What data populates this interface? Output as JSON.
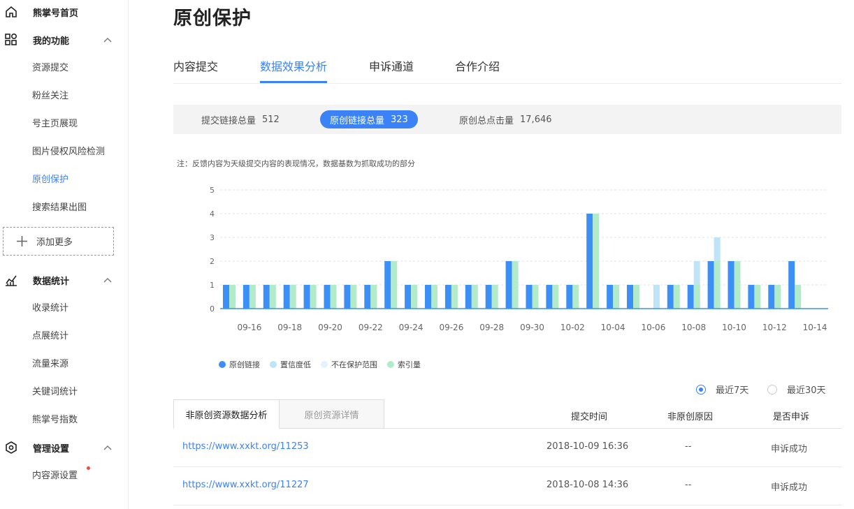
{
  "sidebar": {
    "home": {
      "label": "熊掌号首页"
    },
    "sections": [
      {
        "label": "我的功能",
        "items": [
          {
            "label": "资源提交"
          },
          {
            "label": "粉丝关注"
          },
          {
            "label": "号主页展现"
          },
          {
            "label": "图片侵权风险检测"
          },
          {
            "label": "原创保护"
          },
          {
            "label": "搜索结果出图"
          }
        ]
      },
      {
        "label": "数据统计",
        "items": [
          {
            "label": "收录统计"
          },
          {
            "label": "点展统计"
          },
          {
            "label": "流量来源"
          },
          {
            "label": "关键词统计"
          },
          {
            "label": "熊掌号指数"
          }
        ]
      },
      {
        "label": "管理设置",
        "items": [
          {
            "label": "内容源设置"
          }
        ]
      }
    ],
    "add_more": "添加更多"
  },
  "page": {
    "title": "原创保护"
  },
  "tabs": [
    "内容提交",
    "数据效果分析",
    "申诉通道",
    "合作介绍"
  ],
  "active_tab": 1,
  "stats": [
    {
      "label": "提交链接总量",
      "value": "512"
    },
    {
      "label": "原创链接总量",
      "value": "323"
    },
    {
      "label": "原创总点击量",
      "value": "17,646"
    }
  ],
  "note": "注：反馈内容为天级提交内容的表现情况，数据基数为抓取成功的部分",
  "range": {
    "option1": "最近7天",
    "option2": "最近30天",
    "selected": 0
  },
  "table": {
    "tab_active": "非原创资源数据分析",
    "tab_inactive": "原创资源详情",
    "headers": {
      "time": "提交时间",
      "reason": "非原创原因",
      "appeal": "是否申诉"
    },
    "rows": [
      {
        "url": "https://www.xxkt.org/11253",
        "time": "2018-10-09 16:36",
        "reason": "--",
        "appeal": "申诉成功"
      },
      {
        "url": "https://www.xxkt.org/11227",
        "time": "2018-10-08 14:36",
        "reason": "--",
        "appeal": "申诉成功"
      }
    ]
  },
  "colors": {
    "accent": "#3b82f6",
    "series": [
      "#3b8ff5",
      "#bfe3f7",
      "#e4f2fb",
      "#b1ebc9"
    ]
  },
  "chart_data": {
    "type": "bar",
    "categories": [
      "09-15",
      "09-16",
      "09-17",
      "09-18",
      "09-19",
      "09-20",
      "09-21",
      "09-22",
      "09-23",
      "09-24",
      "09-25",
      "09-26",
      "09-27",
      "09-28",
      "09-29",
      "09-30",
      "10-01",
      "10-02",
      "10-03",
      "10-04",
      "10-05",
      "10-06",
      "10-07",
      "10-08",
      "10-09",
      "10-10",
      "10-11",
      "10-12",
      "10-13",
      "10-14"
    ],
    "tick_labels": [
      "09-16",
      "09-18",
      "09-20",
      "09-22",
      "09-24",
      "09-26",
      "09-28",
      "09-30",
      "10-02",
      "10-04",
      "10-06",
      "10-08",
      "10-10",
      "10-12",
      "10-14"
    ],
    "series": [
      {
        "name": "原创链接",
        "color": "#3b8ff5",
        "values": [
          1,
          1,
          1,
          1,
          1,
          1,
          1,
          1,
          2,
          1,
          1,
          1,
          1,
          1,
          2,
          1,
          1,
          1,
          4,
          1,
          1,
          0,
          1,
          1,
          2,
          2,
          1,
          1,
          2,
          0
        ]
      },
      {
        "name": "置信度低",
        "color": "#bfe3f7",
        "values": [
          0,
          0,
          0,
          0,
          0,
          0,
          0,
          0,
          0,
          0,
          0,
          0,
          0,
          0,
          0,
          0,
          0,
          0,
          0,
          0,
          0,
          1,
          0,
          2,
          3,
          0,
          0,
          0,
          0,
          0
        ]
      },
      {
        "name": "不在保护范围",
        "color": "#e4f2fb",
        "values": [
          0,
          0,
          0,
          0,
          0,
          0,
          0,
          0,
          0,
          0,
          0,
          0,
          0,
          0,
          0,
          0,
          0,
          0,
          0,
          0,
          0,
          0,
          0,
          0,
          0,
          0,
          0,
          0,
          0,
          0
        ]
      },
      {
        "name": "索引量",
        "color": "#b1ebc9",
        "values": [
          1,
          1,
          1,
          1,
          1,
          1,
          1,
          1,
          2,
          1,
          1,
          1,
          1,
          1,
          2,
          1,
          1,
          1,
          4,
          1,
          1,
          0,
          1,
          1,
          2,
          2,
          1,
          1,
          1,
          0
        ]
      }
    ],
    "ylim": [
      0,
      5
    ],
    "yticks": [
      0,
      1,
      2,
      3,
      4,
      5
    ],
    "grid": true,
    "legend": "bottom-left"
  }
}
